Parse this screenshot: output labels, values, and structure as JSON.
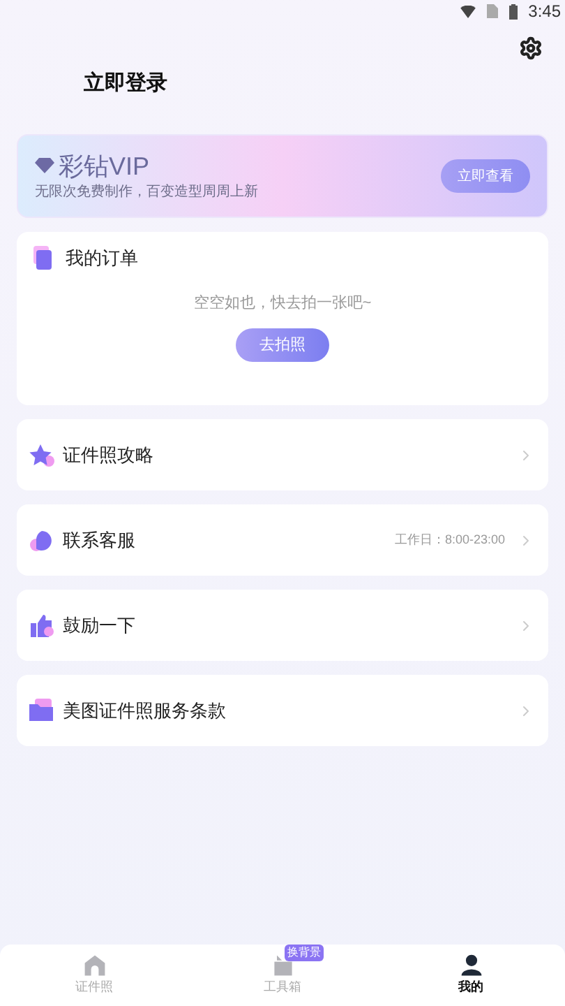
{
  "status_bar": {
    "time": "3:45"
  },
  "header": {
    "login": "立即登录"
  },
  "vip": {
    "title": "彩钻VIP",
    "subtitle": "无限次免费制作，百变造型周周上新",
    "button": "立即查看"
  },
  "orders": {
    "title": "我的订单",
    "empty": "空空如也，快去拍一张吧~",
    "button": "去拍照"
  },
  "menu": [
    {
      "kind": "star",
      "label": "证件照攻略"
    },
    {
      "kind": "chat",
      "label": "联系客服",
      "detail": "工作日：8:00-23:00"
    },
    {
      "kind": "thumb",
      "label": "鼓励一下"
    },
    {
      "kind": "folder",
      "label": "美图证件照服务条款"
    }
  ],
  "tabs": [
    {
      "kind": "home",
      "label": "证件照",
      "selected": false
    },
    {
      "kind": "toolbox",
      "label": "工具箱",
      "selected": false,
      "badge": "换背景"
    },
    {
      "kind": "person",
      "label": "我的",
      "selected": true
    }
  ]
}
